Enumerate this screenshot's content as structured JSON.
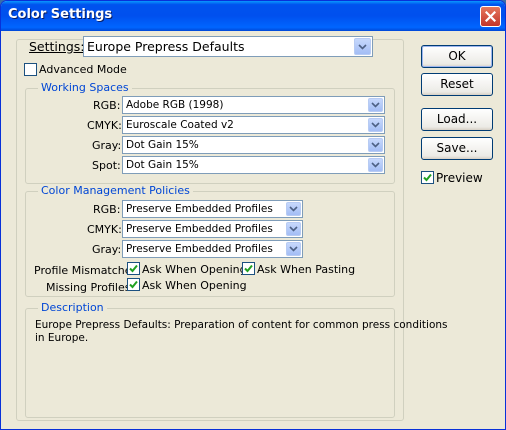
{
  "window": {
    "title": "Color Settings"
  },
  "settings": {
    "label": "Settings:",
    "value": "Europe Prepress Defaults"
  },
  "advanced_mode": {
    "label": "Advanced Mode",
    "checked": false
  },
  "working_spaces": {
    "title": "Working Spaces",
    "rgb": {
      "label": "RGB:",
      "value": "Adobe RGB (1998)"
    },
    "cmyk": {
      "label": "CMYK:",
      "value": "Euroscale Coated v2"
    },
    "gray": {
      "label": "Gray:",
      "value": "Dot Gain 15%"
    },
    "spot": {
      "label": "Spot:",
      "value": "Dot Gain 15%"
    }
  },
  "policies": {
    "title": "Color Management Policies",
    "rgb": {
      "label": "RGB:",
      "value": "Preserve Embedded Profiles"
    },
    "cmyk": {
      "label": "CMYK:",
      "value": "Preserve Embedded Profiles"
    },
    "gray": {
      "label": "Gray:",
      "value": "Preserve Embedded Profiles"
    },
    "profile_mismatches": {
      "label": "Profile Mismatches:",
      "ask_opening": "Ask When Opening",
      "ask_pasting": "Ask When Pasting",
      "opening_checked": true,
      "pasting_checked": true
    },
    "missing_profiles": {
      "label": "Missing Profiles:",
      "ask_opening": "Ask When Opening",
      "opening_checked": true
    }
  },
  "description": {
    "title": "Description",
    "text": "Europe Prepress Defaults:  Preparation of content for common press conditions in Europe."
  },
  "buttons": {
    "ok": "OK",
    "reset": "Reset",
    "load": "Load...",
    "save": "Save..."
  },
  "preview": {
    "label": "Preview",
    "checked": true
  },
  "colors": {
    "titlebar": "#0054e3",
    "group_title": "#0046d5",
    "dialog_bg": "#ece9d8"
  }
}
